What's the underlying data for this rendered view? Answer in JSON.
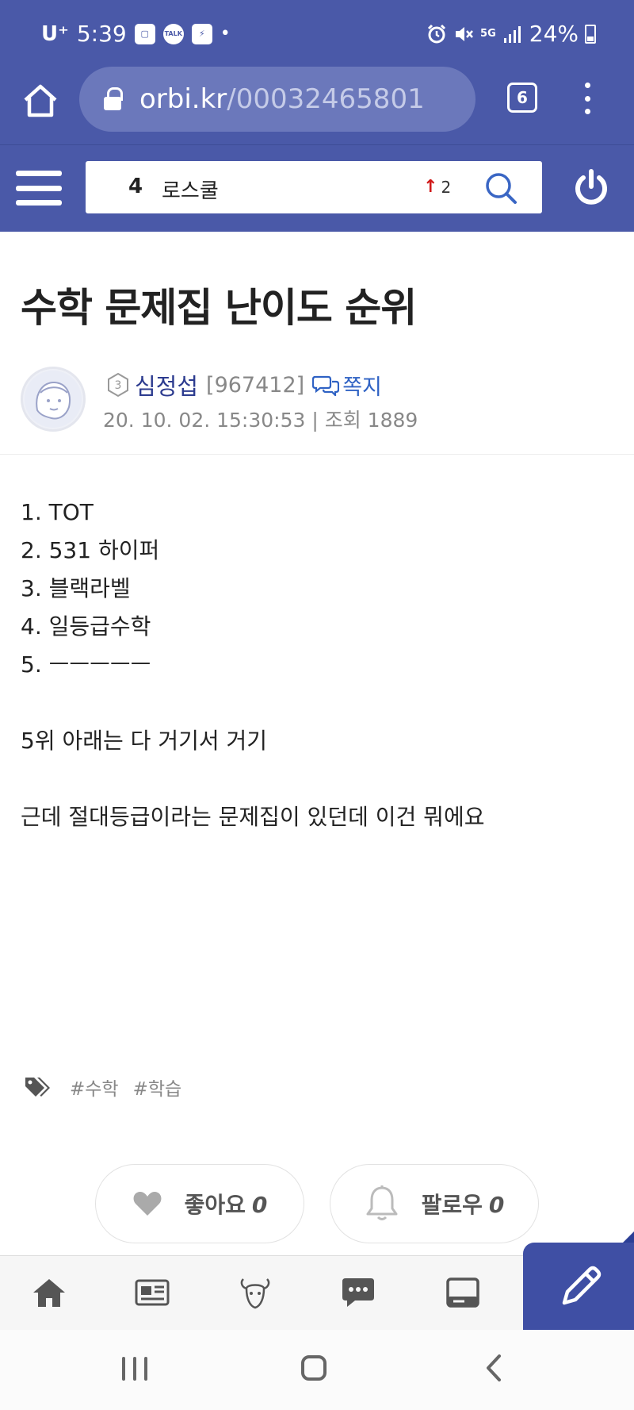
{
  "status_bar": {
    "carrier": "U⁺",
    "time": "5:39",
    "notif_icons": [
      "messenger-icon",
      "talk-icon",
      "app-icon"
    ],
    "talk_label": "TALK",
    "signal_label": "5G",
    "battery": "24%"
  },
  "browser": {
    "url_host": "orbi.kr",
    "url_path": "/00032465801",
    "tab_count": "6"
  },
  "site_header": {
    "rank_number": "4",
    "rank_keyword": "로스쿨",
    "rank_change": "2",
    "rank_direction": "up"
  },
  "post": {
    "title": "수학 문제집 난이도 순위",
    "author": {
      "level": "3",
      "name": "심정섭",
      "id": "[967412]",
      "message_label": "쪽지"
    },
    "meta": "20. 10. 02. 15:30:53 | 조회 1889",
    "body": [
      "1. TOT",
      "2. 531 하이퍼",
      "3. 블랙라벨",
      "4. 일등급수학",
      "5. ㅡㅡㅡㅡㅡ",
      "",
      "5위 아래는 다 거기서 거기",
      "",
      "근데 절대등급이라는 문제집이 있던데 이건 뭐에요"
    ],
    "tags": [
      "#수학",
      "#학습"
    ]
  },
  "actions": {
    "like_label": "좋아요",
    "like_count": "0",
    "follow_label": "팔로우",
    "follow_count": "0"
  },
  "bottom_nav": {
    "items": [
      "home-icon",
      "news-icon",
      "goat-icon",
      "chat-icon",
      "board-icon"
    ],
    "write_icon": "pencil-icon"
  },
  "colors": {
    "brand": "#4a59a8",
    "author_link": "#2c3b8f",
    "message_link": "#2f62c4",
    "rank_up": "#d01818"
  }
}
